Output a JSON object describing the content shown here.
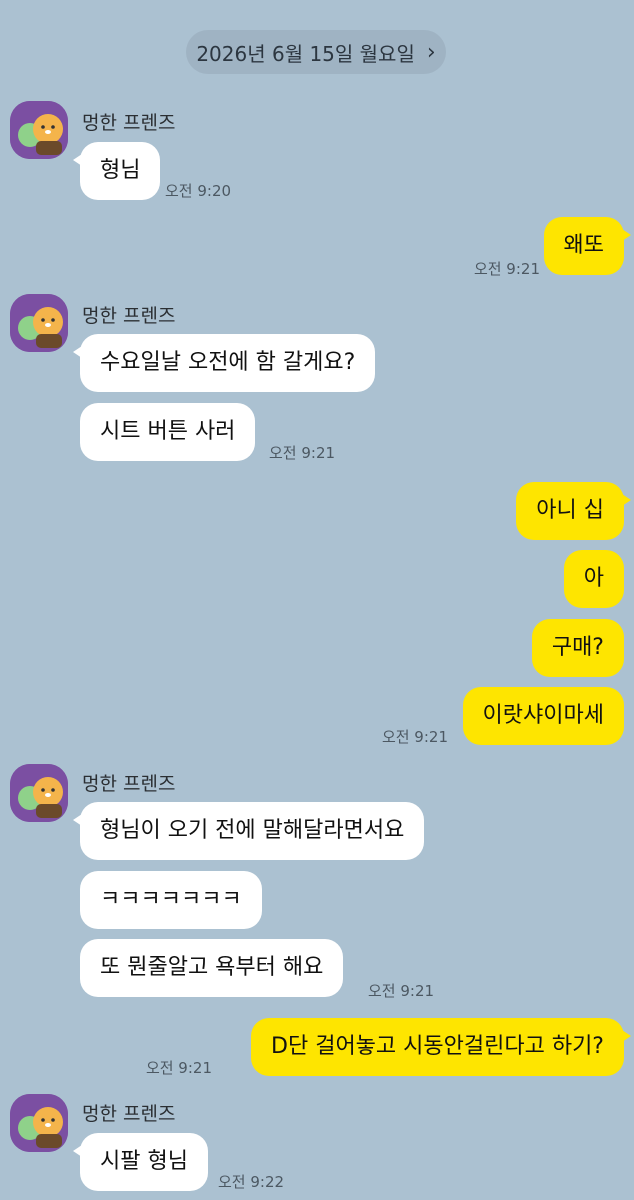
{
  "date_divider": {
    "label": "2026년 6월 15일 월요일",
    "chevron": "›"
  },
  "sender_name": "멍한 프렌즈",
  "avatar_icon": "cartoon-friends-avatar",
  "colors": {
    "background": "#abc1d1",
    "incoming": "#ffffff",
    "outgoing": "#fee500",
    "avatar": "#7b4fa2"
  },
  "messages": [
    {
      "dir": "in",
      "text": "형님",
      "time": "오전 9:20"
    },
    {
      "dir": "out",
      "text": "왜또",
      "time": "오전 9:21"
    },
    {
      "dir": "in",
      "text": "수요일날 오전에 함 갈게요?"
    },
    {
      "dir": "in",
      "text": "시트 버튼 사러",
      "time": "오전 9:21"
    },
    {
      "dir": "out",
      "text": "아니 십"
    },
    {
      "dir": "out",
      "text": "아"
    },
    {
      "dir": "out",
      "text": "구매?"
    },
    {
      "dir": "out",
      "text": "이랏샤이마세",
      "time": "오전 9:21"
    },
    {
      "dir": "in",
      "text": "형님이 오기 전에 말해달라면서요"
    },
    {
      "dir": "in",
      "text": "ㅋㅋㅋㅋㅋㅋㅋ"
    },
    {
      "dir": "in",
      "text": "또 뭔줄알고 욕부터 해요",
      "time": "오전 9:21"
    },
    {
      "dir": "out",
      "text": "D단 걸어놓고 시동안걸린다고 하기?",
      "time": "오전 9:21"
    },
    {
      "dir": "in",
      "text": "시팔 형님",
      "time": "오전 9:22"
    }
  ]
}
